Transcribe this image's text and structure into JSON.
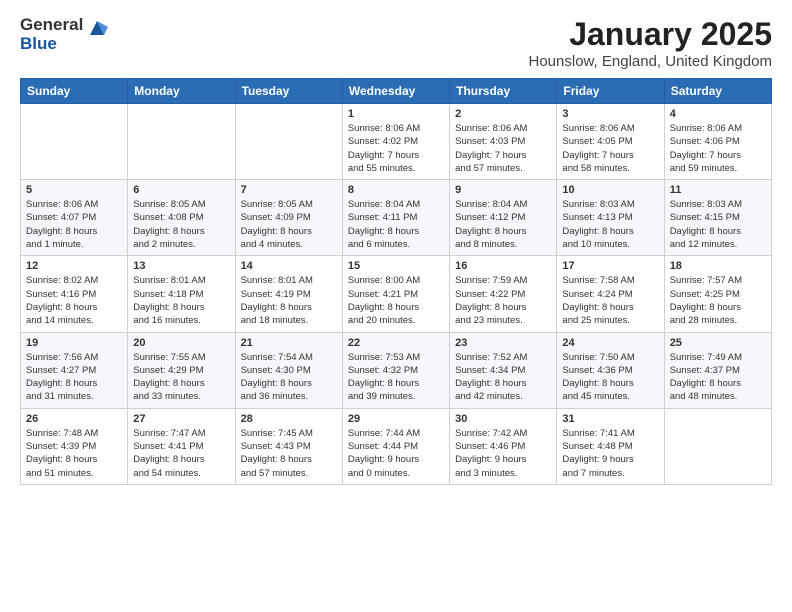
{
  "logo": {
    "general": "General",
    "blue": "Blue"
  },
  "header": {
    "title": "January 2025",
    "subtitle": "Hounslow, England, United Kingdom"
  },
  "days_of_week": [
    "Sunday",
    "Monday",
    "Tuesday",
    "Wednesday",
    "Thursday",
    "Friday",
    "Saturday"
  ],
  "weeks": [
    [
      {
        "day": "",
        "info": ""
      },
      {
        "day": "",
        "info": ""
      },
      {
        "day": "",
        "info": ""
      },
      {
        "day": "1",
        "info": "Sunrise: 8:06 AM\nSunset: 4:02 PM\nDaylight: 7 hours\nand 55 minutes."
      },
      {
        "day": "2",
        "info": "Sunrise: 8:06 AM\nSunset: 4:03 PM\nDaylight: 7 hours\nand 57 minutes."
      },
      {
        "day": "3",
        "info": "Sunrise: 8:06 AM\nSunset: 4:05 PM\nDaylight: 7 hours\nand 58 minutes."
      },
      {
        "day": "4",
        "info": "Sunrise: 8:06 AM\nSunset: 4:06 PM\nDaylight: 7 hours\nand 59 minutes."
      }
    ],
    [
      {
        "day": "5",
        "info": "Sunrise: 8:06 AM\nSunset: 4:07 PM\nDaylight: 8 hours\nand 1 minute."
      },
      {
        "day": "6",
        "info": "Sunrise: 8:05 AM\nSunset: 4:08 PM\nDaylight: 8 hours\nand 2 minutes."
      },
      {
        "day": "7",
        "info": "Sunrise: 8:05 AM\nSunset: 4:09 PM\nDaylight: 8 hours\nand 4 minutes."
      },
      {
        "day": "8",
        "info": "Sunrise: 8:04 AM\nSunset: 4:11 PM\nDaylight: 8 hours\nand 6 minutes."
      },
      {
        "day": "9",
        "info": "Sunrise: 8:04 AM\nSunset: 4:12 PM\nDaylight: 8 hours\nand 8 minutes."
      },
      {
        "day": "10",
        "info": "Sunrise: 8:03 AM\nSunset: 4:13 PM\nDaylight: 8 hours\nand 10 minutes."
      },
      {
        "day": "11",
        "info": "Sunrise: 8:03 AM\nSunset: 4:15 PM\nDaylight: 8 hours\nand 12 minutes."
      }
    ],
    [
      {
        "day": "12",
        "info": "Sunrise: 8:02 AM\nSunset: 4:16 PM\nDaylight: 8 hours\nand 14 minutes."
      },
      {
        "day": "13",
        "info": "Sunrise: 8:01 AM\nSunset: 4:18 PM\nDaylight: 8 hours\nand 16 minutes."
      },
      {
        "day": "14",
        "info": "Sunrise: 8:01 AM\nSunset: 4:19 PM\nDaylight: 8 hours\nand 18 minutes."
      },
      {
        "day": "15",
        "info": "Sunrise: 8:00 AM\nSunset: 4:21 PM\nDaylight: 8 hours\nand 20 minutes."
      },
      {
        "day": "16",
        "info": "Sunrise: 7:59 AM\nSunset: 4:22 PM\nDaylight: 8 hours\nand 23 minutes."
      },
      {
        "day": "17",
        "info": "Sunrise: 7:58 AM\nSunset: 4:24 PM\nDaylight: 8 hours\nand 25 minutes."
      },
      {
        "day": "18",
        "info": "Sunrise: 7:57 AM\nSunset: 4:25 PM\nDaylight: 8 hours\nand 28 minutes."
      }
    ],
    [
      {
        "day": "19",
        "info": "Sunrise: 7:56 AM\nSunset: 4:27 PM\nDaylight: 8 hours\nand 31 minutes."
      },
      {
        "day": "20",
        "info": "Sunrise: 7:55 AM\nSunset: 4:29 PM\nDaylight: 8 hours\nand 33 minutes."
      },
      {
        "day": "21",
        "info": "Sunrise: 7:54 AM\nSunset: 4:30 PM\nDaylight: 8 hours\nand 36 minutes."
      },
      {
        "day": "22",
        "info": "Sunrise: 7:53 AM\nSunset: 4:32 PM\nDaylight: 8 hours\nand 39 minutes."
      },
      {
        "day": "23",
        "info": "Sunrise: 7:52 AM\nSunset: 4:34 PM\nDaylight: 8 hours\nand 42 minutes."
      },
      {
        "day": "24",
        "info": "Sunrise: 7:50 AM\nSunset: 4:36 PM\nDaylight: 8 hours\nand 45 minutes."
      },
      {
        "day": "25",
        "info": "Sunrise: 7:49 AM\nSunset: 4:37 PM\nDaylight: 8 hours\nand 48 minutes."
      }
    ],
    [
      {
        "day": "26",
        "info": "Sunrise: 7:48 AM\nSunset: 4:39 PM\nDaylight: 8 hours\nand 51 minutes."
      },
      {
        "day": "27",
        "info": "Sunrise: 7:47 AM\nSunset: 4:41 PM\nDaylight: 8 hours\nand 54 minutes."
      },
      {
        "day": "28",
        "info": "Sunrise: 7:45 AM\nSunset: 4:43 PM\nDaylight: 8 hours\nand 57 minutes."
      },
      {
        "day": "29",
        "info": "Sunrise: 7:44 AM\nSunset: 4:44 PM\nDaylight: 9 hours\nand 0 minutes."
      },
      {
        "day": "30",
        "info": "Sunrise: 7:42 AM\nSunset: 4:46 PM\nDaylight: 9 hours\nand 3 minutes."
      },
      {
        "day": "31",
        "info": "Sunrise: 7:41 AM\nSunset: 4:48 PM\nDaylight: 9 hours\nand 7 minutes."
      },
      {
        "day": "",
        "info": ""
      }
    ]
  ]
}
